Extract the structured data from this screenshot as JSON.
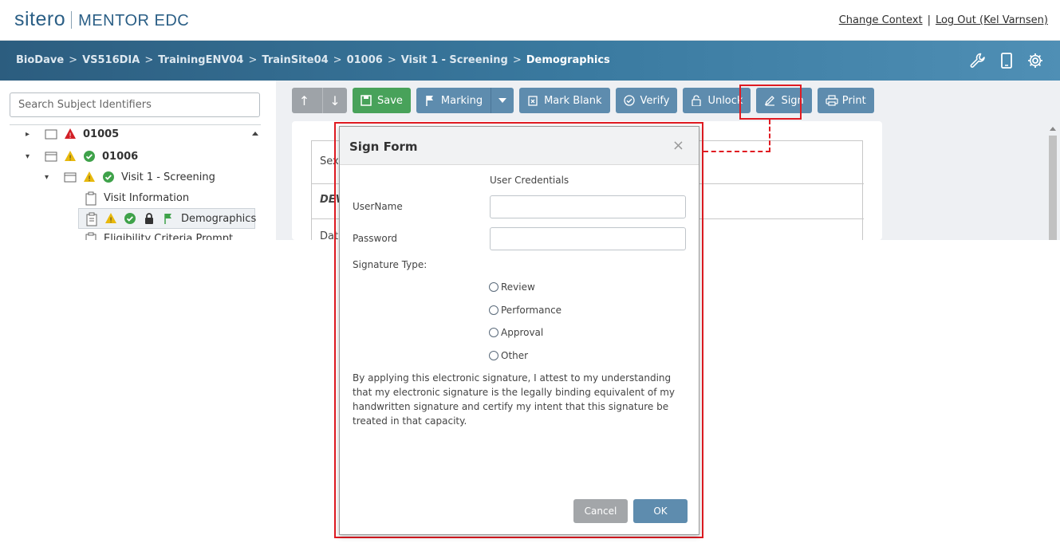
{
  "header": {
    "logo_brand": "sitero",
    "logo_product": "MENTOR EDC",
    "change_context": "Change Context",
    "link_sep": "|",
    "logout": "Log Out (Kel Varnsen)"
  },
  "breadcrumb": {
    "items": [
      "BioDave",
      "VS516DIA",
      "TrainingENV04",
      "TrainSite04",
      "01006",
      "Visit 1 - Screening",
      "Demographics"
    ],
    "separator": ">",
    "icons": [
      "wrench-icon",
      "tablet-icon",
      "gear-icon"
    ]
  },
  "sidebar": {
    "search_placeholder": "Search Subject Identifiers",
    "tree": [
      {
        "label": "01005",
        "bold": true
      },
      {
        "label": "01006",
        "bold": true
      },
      {
        "label": "Visit 1 - Screening"
      },
      {
        "label": "Visit Information"
      },
      {
        "label": "Demographics",
        "selected": true
      },
      {
        "label": "Eligibility Criteria Prompt"
      }
    ]
  },
  "toolbar": {
    "save": "Save",
    "marking": "Marking",
    "mark_blank": "Mark Blank",
    "verify": "Verify",
    "unlock": "Unlock",
    "sign": "Sign",
    "print": "Print"
  },
  "form_fragments": {
    "row1": "Sex",
    "row2": "DEV",
    "row3": "Dat"
  },
  "modal": {
    "title": "Sign Form",
    "close": "×",
    "section": "User Credentials",
    "username_label": "UserName",
    "password_label": "Password",
    "sig_type_label": "Signature Type:",
    "options": [
      "Review",
      "Performance",
      "Approval",
      "Other"
    ],
    "attestation": "By applying this electronic signature, I attest to my understanding that my electronic signature is the legally binding equivalent of my handwritten signature and certify my intent that this signature be treated in that capacity.",
    "cancel": "Cancel",
    "ok": "OK"
  },
  "colors": {
    "accent": "#5e8cae",
    "save_green": "#48a25a",
    "highlight_red": "#e01b22",
    "warning_yellow": "#e8b90c",
    "ok_green": "#3fa24a"
  }
}
